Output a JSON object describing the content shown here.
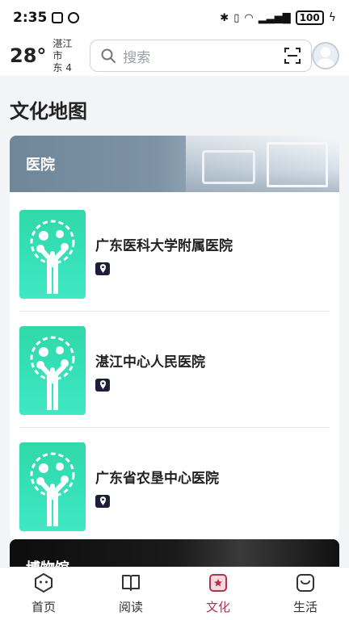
{
  "status_bar": {
    "time": "2:35",
    "battery": "100"
  },
  "header": {
    "temperature": "28°",
    "city": "湛江市",
    "wind": "东 4",
    "search_placeholder": "搜索"
  },
  "page": {
    "title": "文化地图"
  },
  "sections": [
    {
      "label": "医院",
      "items": [
        {
          "name": "广东医科大学附属医院"
        },
        {
          "name": "湛江中心人民医院"
        },
        {
          "name": "广东省农垦中心医院"
        }
      ]
    },
    {
      "label": "博物馆"
    }
  ],
  "bottom_nav": {
    "items": [
      {
        "label": "首页",
        "icon": "home-icon"
      },
      {
        "label": "阅读",
        "icon": "book-icon"
      },
      {
        "label": "文化",
        "icon": "culture-icon"
      },
      {
        "label": "生活",
        "icon": "life-icon"
      }
    ],
    "active_index": 2,
    "active_color": "#b0344e"
  },
  "colors": {
    "thumb_green": "#35e0b7",
    "loc_badge": "#1c1f3b"
  }
}
